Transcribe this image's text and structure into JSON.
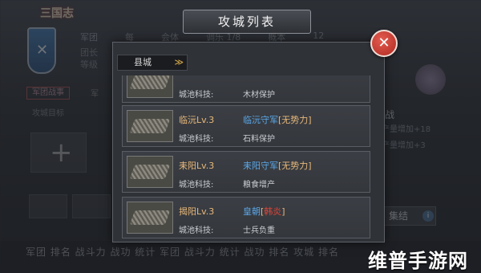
{
  "background": {
    "logo": "三国志",
    "stats_row": [
      "军团",
      "每",
      "会体",
      "调乐 1/8",
      "概本",
      "12"
    ],
    "left_text": [
      "团长",
      "等级"
    ],
    "tab_active": "军团战事",
    "tab_other": "军",
    "section_label": "攻城目标",
    "right_title": "战",
    "right_lines": [
      "产量增加+18",
      "产量增加+3"
    ],
    "assemble_button": "集结",
    "assemble_info": "i",
    "bottom_text": "军团 排名 战斗力 战功 统计 军团 战斗力 统计 战功 排名 攻城 排名"
  },
  "watermark": "维普手游网",
  "modal": {
    "title": "攻城列表",
    "close_glyph": "✕",
    "dropdown": {
      "selected": "县城",
      "chevron": "≫"
    }
  },
  "rows": [
    {
      "city": "",
      "defender": "",
      "faction": "",
      "faction_color": "none",
      "tech_label": "城池科技:",
      "tech_value": "木材保护"
    },
    {
      "city": "临沅Lv.3",
      "defender": "临沅守军",
      "faction": "无势力",
      "faction_color": "yellow",
      "tech_label": "城池科技:",
      "tech_value": "石料保护"
    },
    {
      "city": "耒阳Lv.3",
      "defender": "耒阳守军",
      "faction": "无势力",
      "faction_color": "yellow",
      "tech_label": "城池科技:",
      "tech_value": "粮食增产"
    },
    {
      "city": "揭阳Lv.3",
      "defender": "皇朝",
      "faction": "韩炎",
      "faction_color": "red",
      "tech_label": "城池科技:",
      "tech_value": "士兵负重"
    }
  ]
}
